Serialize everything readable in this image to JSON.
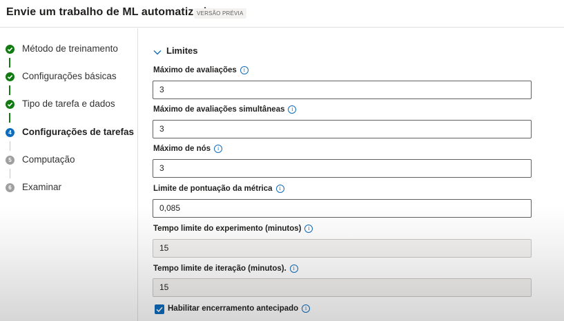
{
  "header": {
    "title": "Envie um trabalho de ML automatizado",
    "badge": "VERSÃO PRÉVIA"
  },
  "steps": [
    {
      "label": "Método de treinamento",
      "state": "done",
      "number": ""
    },
    {
      "label": "Configurações básicas",
      "state": "done",
      "number": ""
    },
    {
      "label": "Tipo de tarefa e dados",
      "state": "done",
      "number": ""
    },
    {
      "label": "Configurações de tarefas",
      "state": "current",
      "number": "4"
    },
    {
      "label": "Computação",
      "state": "todo",
      "number": "5"
    },
    {
      "label": "Examinar",
      "state": "todo",
      "number": "6"
    }
  ],
  "section": {
    "title": "Limites",
    "fields": [
      {
        "label": "Máximo de avaliações",
        "value": "3",
        "disabled": false
      },
      {
        "label": "Máximo de avaliações simultâneas",
        "value": "3",
        "disabled": false
      },
      {
        "label": "Máximo de nós",
        "value": "3",
        "disabled": false
      },
      {
        "label": "Limite de pontuação da métrica",
        "value": "0,085",
        "disabled": false
      },
      {
        "label": "Tempo limite do experimento (minutos)",
        "value": "15",
        "disabled": true
      },
      {
        "label": "Tempo limite de iteração (minutos).",
        "value": "15",
        "disabled": true
      }
    ],
    "checkbox": {
      "label": "Habilitar encerramento antecipado",
      "checked": true
    }
  },
  "colors": {
    "done": "#107c10",
    "current": "#0f6cbd",
    "todo": "#a19f9d"
  }
}
